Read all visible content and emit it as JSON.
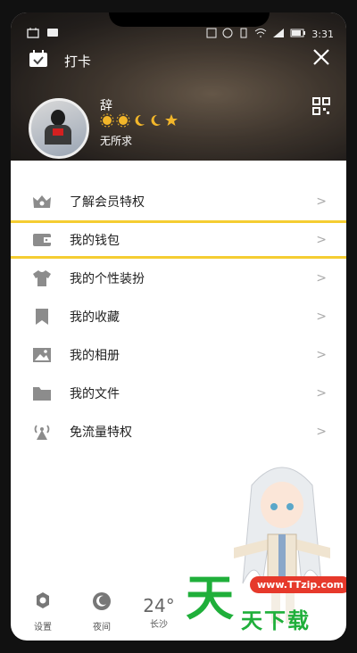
{
  "status_bar": {
    "time": "3:31"
  },
  "header": {
    "checkin_label": "打卡",
    "username": "辞",
    "signature": "无所求"
  },
  "menu": {
    "items": [
      {
        "label": "了解会员特权",
        "icon": "crown-icon"
      },
      {
        "label": "我的钱包",
        "icon": "wallet-icon"
      },
      {
        "label": "我的个性装扮",
        "icon": "shirt-icon"
      },
      {
        "label": "我的收藏",
        "icon": "bookmark-icon"
      },
      {
        "label": "我的相册",
        "icon": "image-icon"
      },
      {
        "label": "我的文件",
        "icon": "folder-icon"
      },
      {
        "label": "免流量特权",
        "icon": "signal-tower-icon"
      }
    ],
    "chevron": ">"
  },
  "bottom_bar": {
    "settings_label": "设置",
    "night_label": "夜间",
    "temperature": "24°",
    "city": "长沙"
  },
  "watermark": {
    "url": "www.TTzip.com",
    "big_char": "天",
    "text": "天下载"
  },
  "colors": {
    "active_border": "#f5cd32",
    "icon_gray": "#8c8c8c",
    "watermark_green": "#1faf3a",
    "watermark_red": "#e6392b"
  }
}
